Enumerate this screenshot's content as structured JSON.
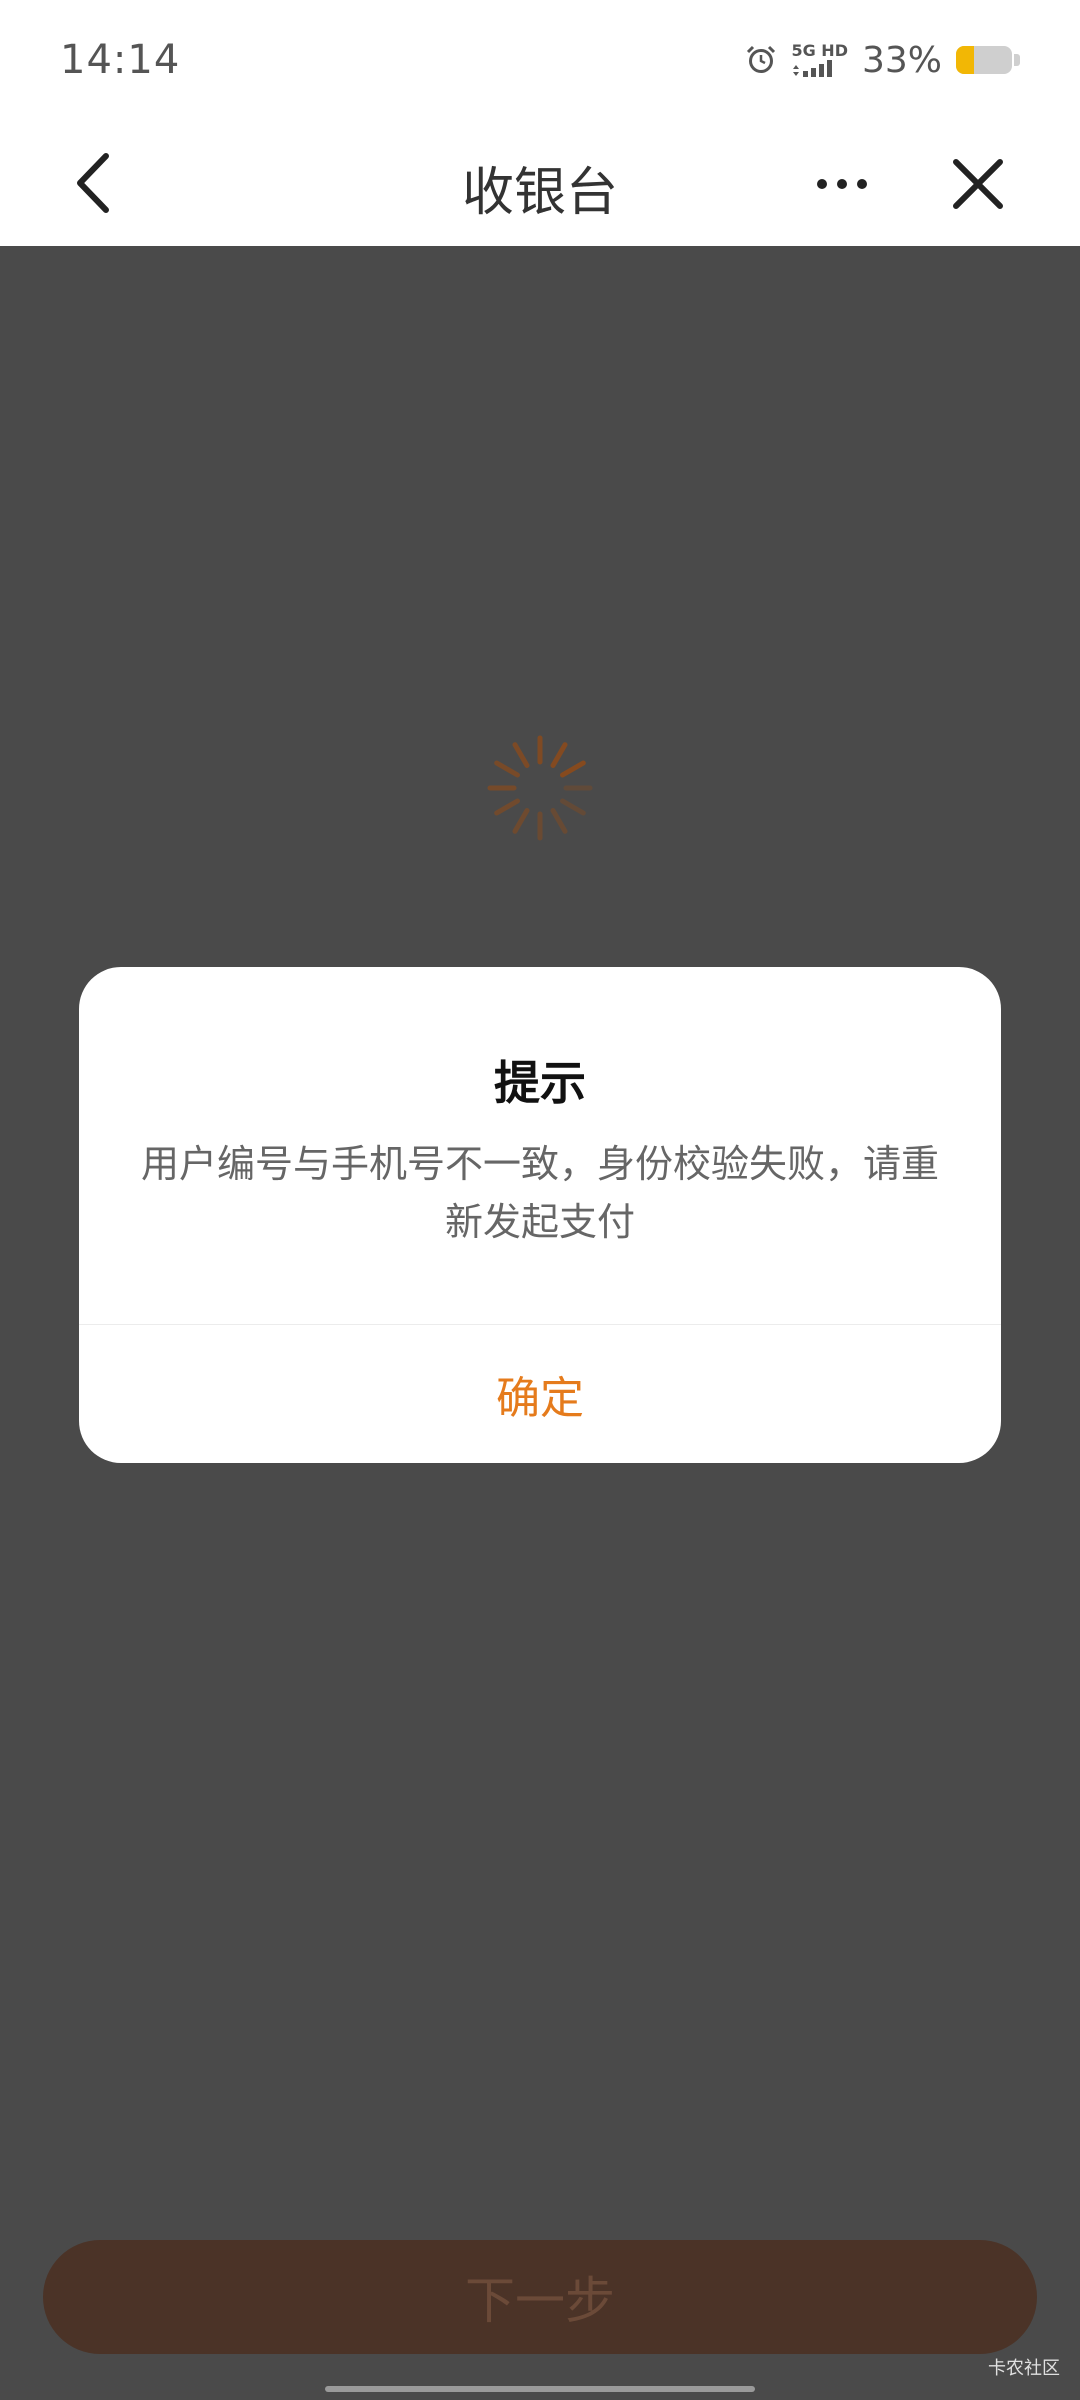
{
  "status_bar": {
    "time": "14:14",
    "network_top": "5G HD",
    "battery_text": "33%",
    "battery_level": 0.33,
    "alarm_icon": "alarm-icon",
    "signal_icon": "signal-icon"
  },
  "nav": {
    "title": "收银台",
    "back_icon": "back-arrow-icon",
    "more_icon": "more-dots-icon",
    "close_icon": "close-icon"
  },
  "loading": {
    "icon": "loading-spinner-icon",
    "color": "#8a4a1c"
  },
  "dialog": {
    "title": "提示",
    "message": "用户编号与手机号不一致，身份校验失败，请重新发起支付",
    "confirm_label": "确定",
    "confirm_color": "#e57b1c"
  },
  "footer": {
    "next_label": "下一步",
    "watermark": "卡农社区"
  },
  "colors": {
    "overlay": "#4a4a4a",
    "accent": "#e57b1c",
    "battery": "#f2b705"
  }
}
